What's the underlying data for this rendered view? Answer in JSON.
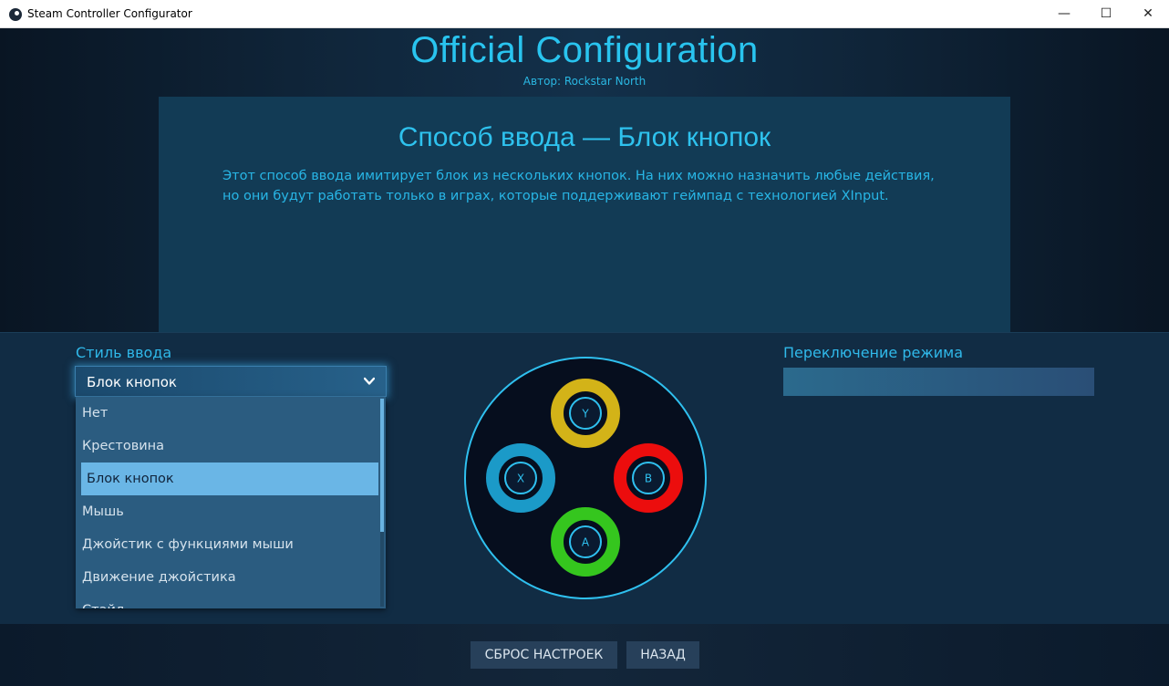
{
  "window": {
    "title": "Steam Controller Configurator",
    "minimize_glyph": "—",
    "maximize_glyph": "☐",
    "close_glyph": "✕"
  },
  "config": {
    "title": "Official Configuration",
    "author": "Автор: Rockstar North"
  },
  "description": {
    "title": "Способ ввода — Блок кнопок",
    "body": "Этот способ ввода имитирует блок из нескольких кнопок. На них можно назначить любые действия, но они будут работать только в играх, которые поддерживают геймпад с технологией XInput."
  },
  "input_style": {
    "label": "Стиль ввода",
    "selected": "Блок кнопок",
    "options": [
      "Нет",
      "Крестовина",
      "Блок кнопок",
      "Мышь",
      "Джойстик с функциями мыши",
      "Движение джойстика",
      "Стайл"
    ],
    "selected_index": 2
  },
  "mode_switch": {
    "label": "Переключение режима"
  },
  "buttons_pad": {
    "y": "Y",
    "x": "X",
    "b": "B",
    "a": "A"
  },
  "colors": {
    "accent": "#29c4ef",
    "y_color": "#d3b318",
    "x_color": "#1b9ac8",
    "b_color": "#ec0d0d",
    "a_color": "#35c61e"
  },
  "footer": {
    "reset_label": "СБРОС НАСТРОЕК",
    "back_label": "НАЗАД"
  }
}
